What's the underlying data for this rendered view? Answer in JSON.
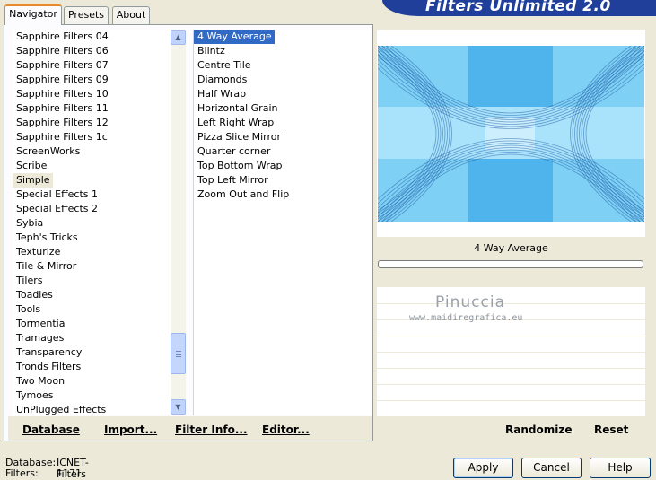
{
  "window": {
    "title": "Filters Unlimited 2.0"
  },
  "tabs": [
    {
      "label": "Navigator",
      "active": true
    },
    {
      "label": "Presets",
      "active": false
    },
    {
      "label": "About",
      "active": false
    }
  ],
  "categories": {
    "items": [
      "Sapphire Filters 04",
      "Sapphire Filters 06",
      "Sapphire Filters 07",
      "Sapphire Filters 09",
      "Sapphire Filters 10",
      "Sapphire Filters 11",
      "Sapphire Filters 12",
      "Sapphire Filters 1c",
      "ScreenWorks",
      "Scribe",
      "Simple",
      "Special Effects 1",
      "Special Effects 2",
      "Sybia",
      "Teph's Tricks",
      "Texturize",
      "Tile & Mirror",
      "Tilers",
      "Toadies",
      "Tools",
      "Tormentia",
      "Tramages",
      "Transparency",
      "Tronds Filters",
      "Two Moon",
      "Tymoes",
      "UnPlugged Effects"
    ],
    "selected": "Simple"
  },
  "filters": {
    "items": [
      "4 Way Average",
      "Blintz",
      "Centre Tile",
      "Diamonds",
      "Half Wrap",
      "Horizontal Grain",
      "Left Right Wrap",
      "Pizza Slice Mirror",
      "Quarter corner",
      "Top Bottom Wrap",
      "Top Left Mirror",
      "Zoom Out and Flip"
    ],
    "selected": "4 Way Average"
  },
  "toolbar": {
    "database_label": "Database",
    "import_label": "Import...",
    "filter_info_label": "Filter Info...",
    "editor_label": "Editor...",
    "randomize_label": "Randomize",
    "reset_label": "Reset"
  },
  "preview": {
    "filter_name": "4 Way Average",
    "progress": 0,
    "watermark_name": "Pinuccia",
    "watermark_url": "www.maidiregrafica.eu",
    "colors": {
      "light": "#7fd0f5",
      "mid": "#4fb3ec",
      "dark": "#1f5fa8"
    }
  },
  "status": {
    "database_key": "Database:",
    "database_value": "ICNET-Filters",
    "filters_key": "Filters:",
    "filters_value": "1171"
  },
  "buttons": {
    "apply": "Apply",
    "cancel": "Cancel",
    "help": "Help"
  }
}
